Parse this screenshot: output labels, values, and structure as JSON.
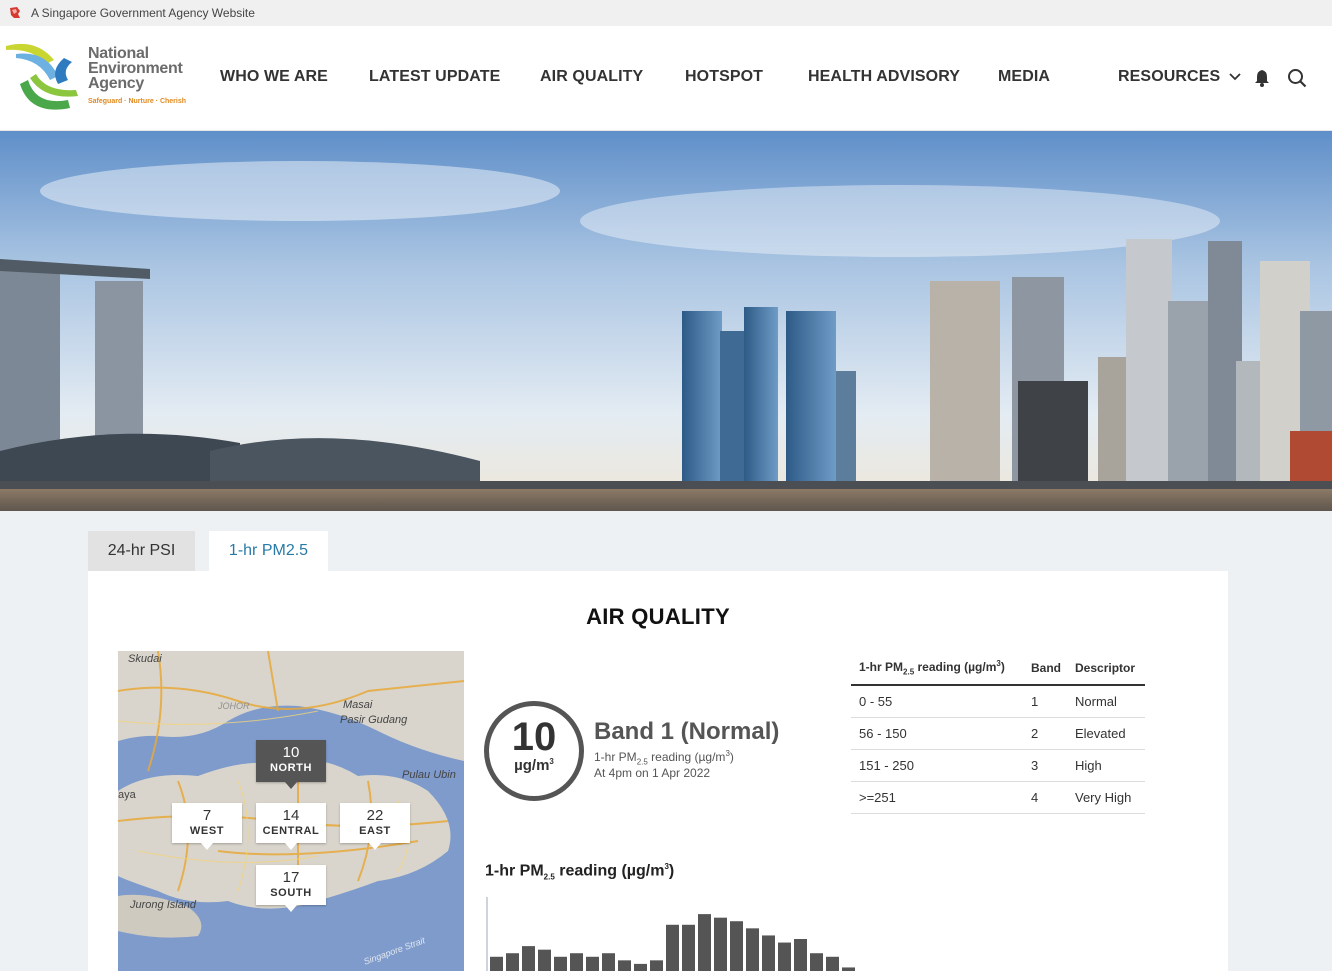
{
  "govbar": {
    "text": "A Singapore Government Agency Website"
  },
  "logo": {
    "line1": "National",
    "line2": "Environment",
    "line3": "Agency",
    "tagline": "Safeguard · Nurture · Cherish"
  },
  "nav": {
    "items": [
      "WHO WE ARE",
      "LATEST UPDATE",
      "AIR QUALITY",
      "HOTSPOT",
      "HEALTH ADVISORY",
      "MEDIA",
      "RESOURCES"
    ]
  },
  "tabs": [
    {
      "label": "24-hr PSI",
      "active": false
    },
    {
      "label": "1-hr PM2.5",
      "active": true
    }
  ],
  "panel": {
    "title": "AIR QUALITY"
  },
  "map": {
    "place_labels": [
      "Skudai",
      "Masai",
      "Pasir Gudang",
      "JOHOR",
      "Pulau Ubin",
      "aya",
      "Jurong Island",
      "Singapore Strait"
    ],
    "regions": [
      {
        "value": "10",
        "name": "NORTH",
        "active": true
      },
      {
        "value": "7",
        "name": "WEST",
        "active": false
      },
      {
        "value": "14",
        "name": "CENTRAL",
        "active": false
      },
      {
        "value": "22",
        "name": "EAST",
        "active": false
      },
      {
        "value": "17",
        "name": "SOUTH",
        "active": false
      }
    ]
  },
  "reading": {
    "value": "10",
    "unit_base": "µg/m",
    "unit_sup": "3",
    "band_title": "Band 1 (Normal)",
    "sub_prefix": "1-hr PM",
    "sub_sub": "2.5",
    "sub_suffix": " reading (µg/m",
    "sub_sup": "3",
    "sub_close": ")",
    "time": "At 4pm on 1 Apr 2022"
  },
  "band_table": {
    "header": {
      "col1_prefix": "1-hr PM",
      "col1_sub": "2.5",
      "col1_suffix": " reading (µg/m",
      "col1_sup": "3",
      "col1_close": ")",
      "col2": "Band",
      "col3": "Descriptor"
    },
    "rows": [
      {
        "range": "0 - 55",
        "band": "1",
        "descriptor": "Normal"
      },
      {
        "range": "56 - 150",
        "band": "2",
        "descriptor": "Elevated"
      },
      {
        "range": "151 - 250",
        "band": "3",
        "descriptor": "High"
      },
      {
        "range": ">=251",
        "band": "4",
        "descriptor": "Very High"
      }
    ]
  },
  "chart_title": {
    "prefix": "1-hr PM",
    "sub": "2.5",
    "suffix": " reading (µg/m",
    "sup": "3",
    "close": ")"
  },
  "chart_data": {
    "type": "bar",
    "title": "1-hr PM2.5 reading (µg/m3)",
    "values": [
      4,
      5,
      7,
      6,
      4,
      5,
      4,
      5,
      3,
      2,
      3,
      13,
      13,
      16,
      15,
      14,
      12,
      10,
      8,
      9,
      5,
      4,
      1
    ],
    "bar_color": "#555555",
    "ymax": 18
  }
}
